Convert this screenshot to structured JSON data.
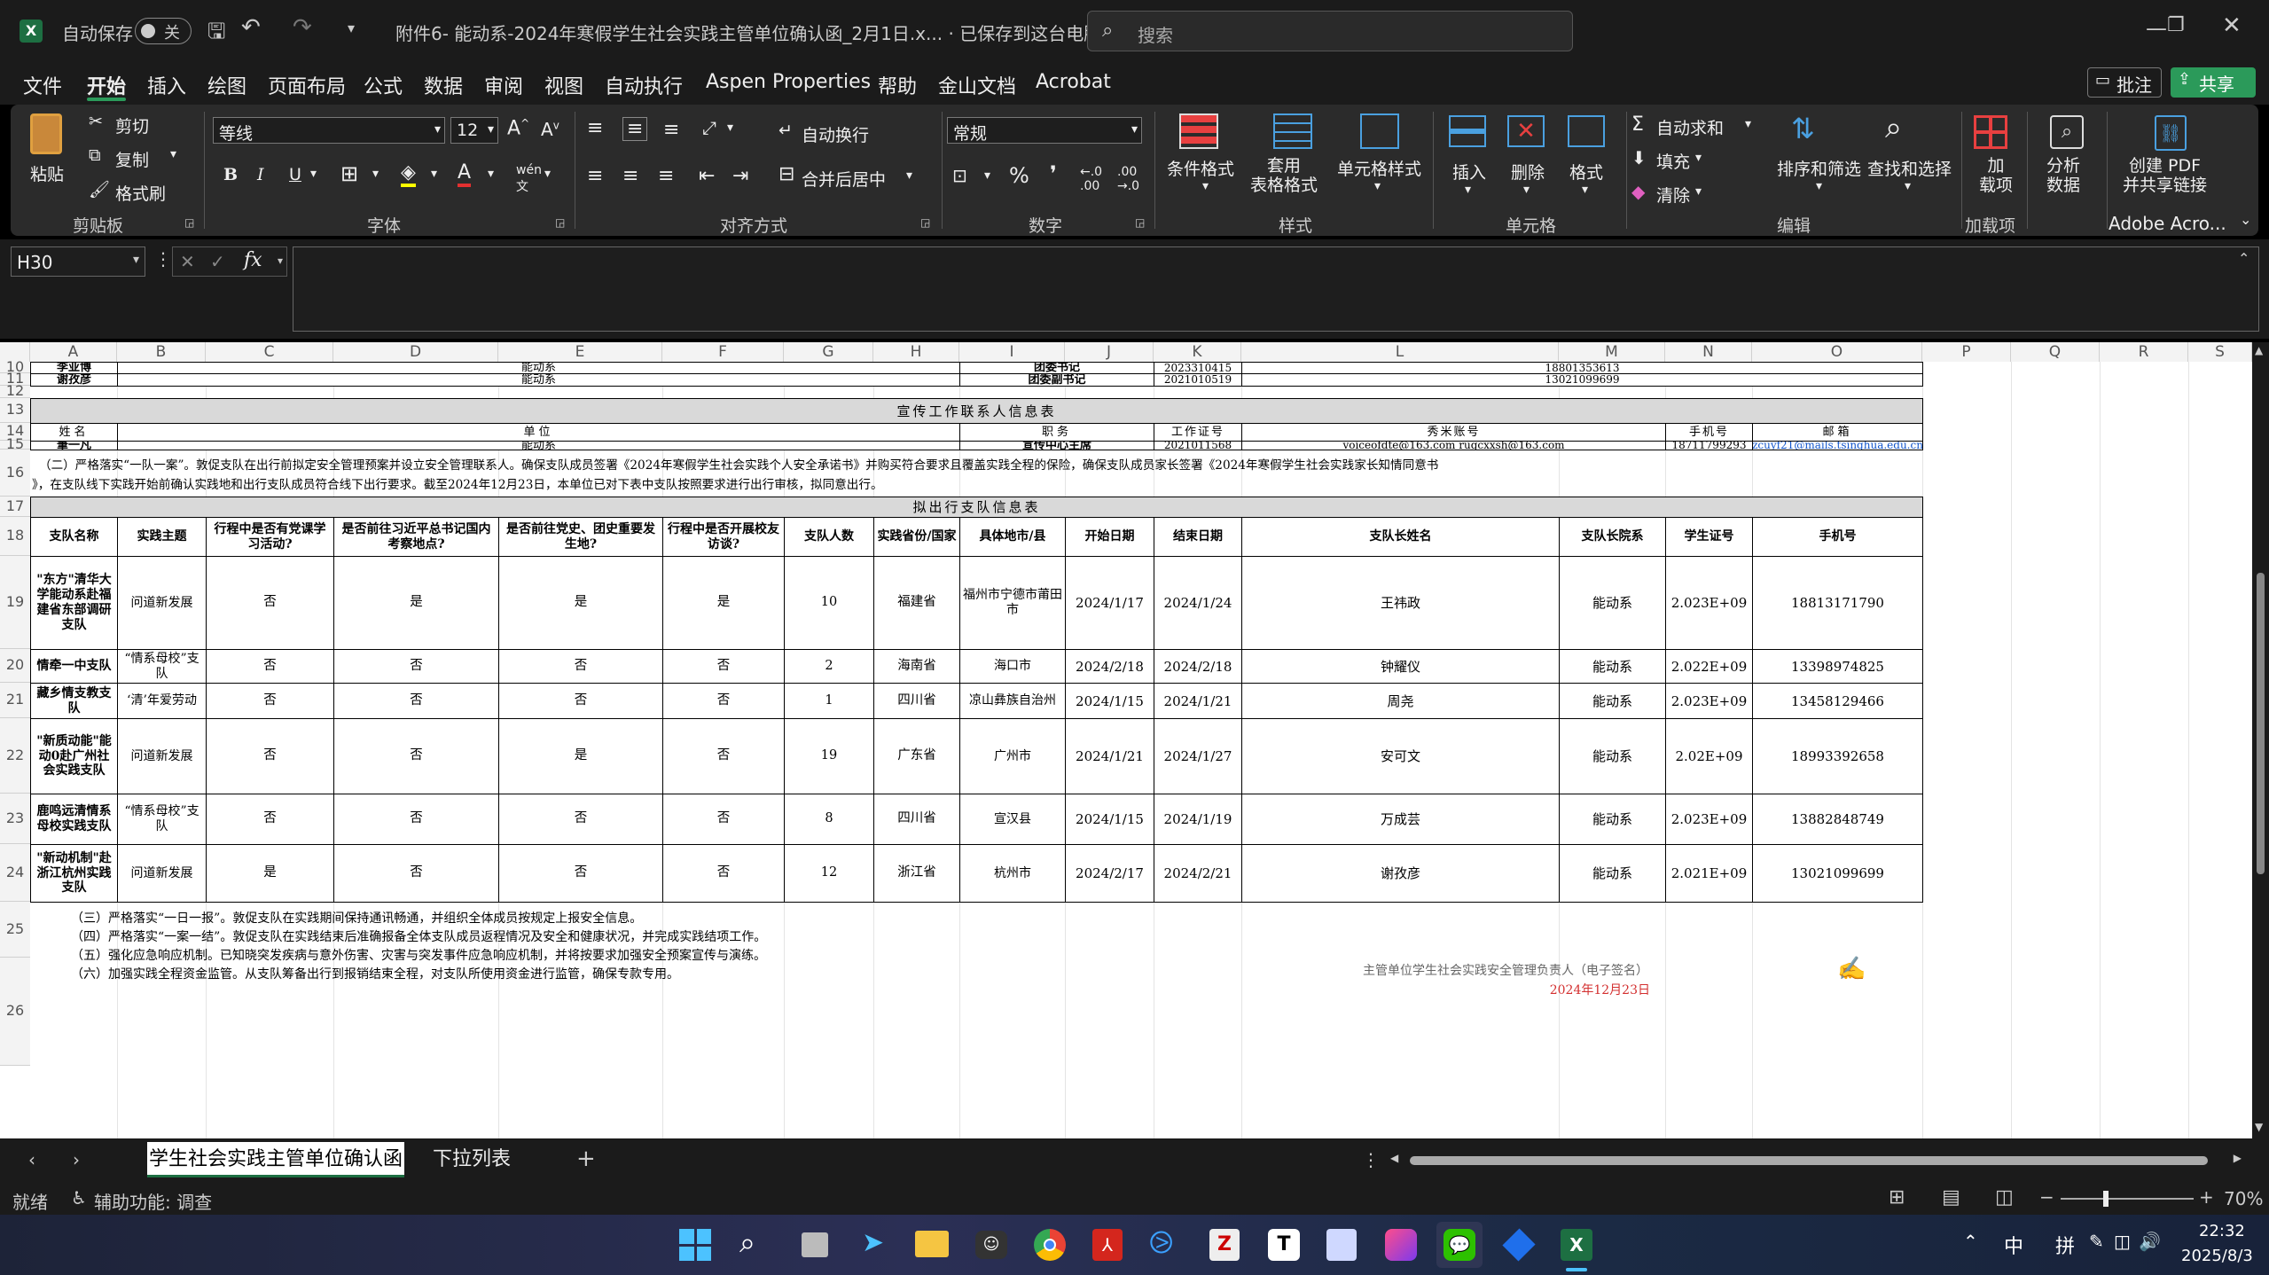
{
  "title": {
    "autosave": "自动保存",
    "toggle": "关",
    "filename": "附件6- 能动系-2024年寒假学生社会实践主管单位确认函_2月1日.x... · 已保存到这台电脑",
    "search": "搜索"
  },
  "menu": [
    "文件",
    "开始",
    "插入",
    "绘图",
    "页面布局",
    "公式",
    "数据",
    "审阅",
    "视图",
    "自动执行",
    "Aspen Properties",
    "帮助",
    "金山文档",
    "Acrobat"
  ],
  "menu_right": {
    "comment": "批注",
    "share": "共享"
  },
  "ribbon": {
    "paste": "粘贴",
    "cut": "剪切",
    "copy": "复制",
    "format_painter": "格式刷",
    "g_clipboard": "剪贴板",
    "font": "等线",
    "size": "12",
    "g_font": "字体",
    "wrap": "自动换行",
    "merge": "合并后居中",
    "g_align": "对齐方式",
    "numfmt": "常规",
    "g_number": "数字",
    "cond": "条件格式",
    "table": "套用\n表格格式",
    "cellstyle": "单元格样式",
    "g_style": "样式",
    "insert": "插入",
    "delete": "删除",
    "format": "格式",
    "g_cells": "单元格",
    "autosum": "自动求和",
    "fill": "填充",
    "clear": "清除",
    "sort": "排序和筛选",
    "find": "查找和选择",
    "g_edit": "编辑",
    "addins": "加\n载项",
    "g_addins": "加载项",
    "analyze": "分析\n数据",
    "pdf": "创建 PDF\n并共享链接",
    "g_adobe": "Adobe Acro..."
  },
  "namebox": "H30",
  "columns": [
    "A",
    "B",
    "C",
    "D",
    "E",
    "F",
    "G",
    "H",
    "I",
    "J",
    "K",
    "L",
    "M",
    "N",
    "O",
    "P",
    "Q",
    "R",
    "S"
  ],
  "rows": [
    "10",
    "11",
    "12",
    "13",
    "14",
    "15",
    "16",
    "17",
    "18",
    "19",
    "20",
    "21",
    "22",
    "23",
    "24",
    "25",
    "26"
  ],
  "r10": {
    "name": "李亚博",
    "unit": "能动系",
    "role": "团委书记",
    "id": "2023310415",
    "phone": "18801353613"
  },
  "r11": {
    "name": "谢孜彦",
    "unit": "能动系",
    "role": "团委副书记",
    "id": "2021010519",
    "phone": "13021099699"
  },
  "publicity_title": "宣传工作联系人信息表",
  "pub_hdr": {
    "name": "姓名",
    "unit": "单位",
    "role": "职务",
    "id": "工作证号",
    "account": "秀米账号",
    "phone": "手机号",
    "email": "邮箱"
  },
  "pub_row": {
    "name": "筆一凡",
    "unit": "能动系",
    "role": "宣传中心主席",
    "id": "2021011568",
    "account": "voiceofdte@163.com rugcxxsh@163.com",
    "phone": "18711799293",
    "email": "zcuyf21@mails.tsinghua.edu.cn"
  },
  "note2": "（二）严格落实“一队一案”。敦促支队在出行前拟定安全管理预案并设立安全管理联系人。确保支队成员签署《2024年寒假学生社会实践个人安全承诺书》并购买符合要求且覆盖实践全程的保险，确保支队成员家长签署《2024年寒假学生社会实践家长知情同意书",
  "note2b": "》，在支队线下实践开始前确认实践地和出行支队成员符合线下出行要求。截至2024年12月23日，本单位已对下表中支队按照要求进行出行审核，拟同意出行。",
  "team_title": "拟出行支队信息表",
  "team_hdr": [
    "支队名称",
    "实践主题",
    "行程中是否有党课学习活动?",
    "是否前往习近平总书记国内考察地点?",
    "是否前往党史、团史重要发生地?",
    "行程中是否开展校友访谈?",
    "支队人数",
    "实践省份/国家",
    "具体地市/县",
    "开始日期",
    "结束日期",
    "支队长姓名",
    "支队长院系",
    "学生证号",
    "手机号"
  ],
  "teams": [
    [
      "\"东方\"清华大学能动系赴福建省东部调研支队",
      "问道新发展",
      "否",
      "是",
      "是",
      "是",
      "10",
      "福建省",
      "福州市宁德市莆田市",
      "2024/1/17",
      "2024/1/24",
      "王祎政",
      "能动系",
      "2.023E+09",
      "18813171790"
    ],
    [
      "情牵一中支队",
      "“情系母校”支队",
      "否",
      "否",
      "否",
      "否",
      "2",
      "海南省",
      "海口市",
      "2024/2/18",
      "2024/2/18",
      "钟耀仪",
      "能动系",
      "2.022E+09",
      "13398974825"
    ],
    [
      "藏乡情支教支队",
      "‘清’年爱劳动",
      "否",
      "否",
      "否",
      "否",
      "1",
      "四川省",
      "凉山彝族自治州",
      "2024/1/15",
      "2024/1/21",
      "周尧",
      "能动系",
      "2.023E+09",
      "13458129466"
    ],
    [
      "\"新质动能\"能动0赴广州社会实践支队",
      "问道新发展",
      "否",
      "否",
      "是",
      "否",
      "19",
      "广东省",
      "广州市",
      "2024/1/21",
      "2024/1/27",
      "安可文",
      "能动系",
      "2.02E+09",
      "18993392658"
    ],
    [
      "鹿鸣远清情系母校实践支队",
      "“情系母校”支队",
      "否",
      "否",
      "否",
      "否",
      "8",
      "四川省",
      "宣汉县",
      "2024/1/15",
      "2024/1/19",
      "万成芸",
      "能动系",
      "2.023E+09",
      "13882848749"
    ],
    [
      "\"新动机制\"赴浙江杭州实践支队",
      "问道新发展",
      "是",
      "否",
      "否",
      "否",
      "12",
      "浙江省",
      "杭州市",
      "2024/2/17",
      "2024/2/21",
      "谢孜彦",
      "能动系",
      "2.021E+09",
      "13021099699"
    ]
  ],
  "notes_bottom": [
    "（三）严格落实“一日一报”。敦促支队在实践期间保持通讯畅通，并组织全体成员按规定上报安全信息。",
    "（四）严格落实“一案一结”。敦促支队在实践结束后准确报备全体支队成员返程情况及安全和健康状况，并完成实践结项工作。",
    "（五）强化应急响应机制。已知晓突发疾病与意外伤害、灾害与突发事件应急响应机制，并将按要求加强安全预案宣传与演练。",
    "（六）加强实践全程资金监管。从支队筹备出行到报销结束全程，对支队所使用资金进行监管，确保专款专用。"
  ],
  "sign": {
    "line": "主管单位学生社会实践安全管理负责人（电子签名）",
    "date": "2024年12月23日"
  },
  "sheets": [
    "学生社会实践主管单位确认函",
    "下拉列表"
  ],
  "status": {
    "ready": "就绪",
    "accessibility": "辅助功能: 调查",
    "zoom": "70%"
  },
  "taskbar": {
    "ime1": "中",
    "ime2": "拼",
    "time": "22:32",
    "date": "2025/8/3"
  }
}
